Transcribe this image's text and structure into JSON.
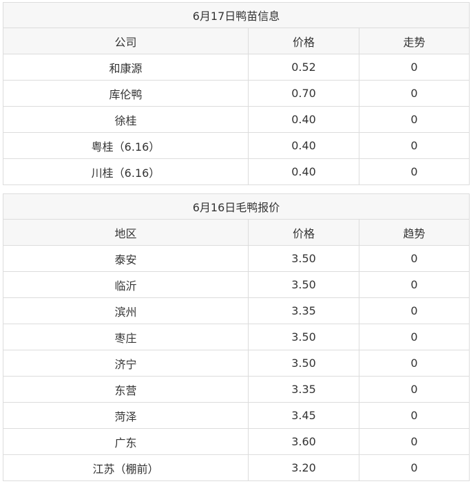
{
  "duckling_table": {
    "title": "6月17日鸭苗信息",
    "headers": [
      "公司",
      "价格",
      "走势"
    ],
    "rows": [
      [
        "和康源",
        "0.52",
        "0"
      ],
      [
        "库伦鸭",
        "0.70",
        "0"
      ],
      [
        "徐桂",
        "0.40",
        "0"
      ],
      [
        "粤桂（6.16）",
        "0.40",
        "0"
      ],
      [
        "川桂（6.16）",
        "0.40",
        "0"
      ]
    ]
  },
  "duck_table": {
    "title": "6月16日毛鸭报价",
    "headers": [
      "地区",
      "价格",
      "趋势"
    ],
    "rows": [
      [
        "泰安",
        "3.50",
        "0"
      ],
      [
        "临沂",
        "3.50",
        "0"
      ],
      [
        "滨州",
        "3.35",
        "0"
      ],
      [
        "枣庄",
        "3.50",
        "0"
      ],
      [
        "济宁",
        "3.50",
        "0"
      ],
      [
        "东营",
        "3.35",
        "0"
      ],
      [
        "菏泽",
        "3.45",
        "0"
      ],
      [
        "广东",
        "3.60",
        "0"
      ],
      [
        "江苏（棚前）",
        "3.20",
        "0"
      ]
    ]
  }
}
